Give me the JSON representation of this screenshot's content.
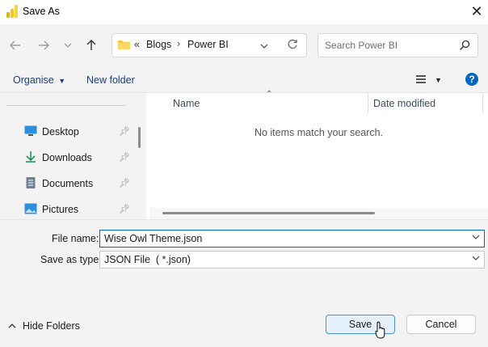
{
  "window": {
    "title": "Save As"
  },
  "address": {
    "overflow": "«",
    "crumbs": [
      "Blogs",
      "Power BI"
    ]
  },
  "search": {
    "placeholder": "Search Power BI"
  },
  "toolbar": {
    "organise": "Organise",
    "new_folder": "New folder"
  },
  "list": {
    "columns": [
      "Name",
      "Date modified"
    ],
    "empty_message": "No items match your search."
  },
  "sidebar": {
    "items": [
      {
        "label": "Desktop",
        "icon": "desktop-icon"
      },
      {
        "label": "Downloads",
        "icon": "download-icon"
      },
      {
        "label": "Documents",
        "icon": "document-icon"
      },
      {
        "label": "Pictures",
        "icon": "pictures-icon"
      }
    ]
  },
  "form": {
    "file_name_label": "File name:",
    "file_name_value": "Wise Owl Theme.json",
    "type_label": "Save as type:",
    "type_value": "JSON File  ( *.json)"
  },
  "footer": {
    "hide_folders": "Hide Folders",
    "save": "Save",
    "cancel": "Cancel"
  },
  "colors": {
    "accent": "#0067c0",
    "powerbi_yellow": "#f2c811",
    "folder": "#f8c846"
  }
}
